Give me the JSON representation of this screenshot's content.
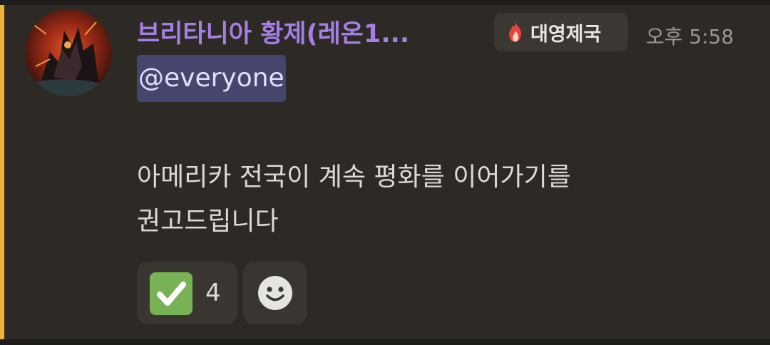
{
  "message": {
    "author": "브리타니아 황제(레온1...",
    "role_tag": {
      "icon": "fire-emoji-icon",
      "label": "대영제국"
    },
    "timestamp": "오후 5:58",
    "mention": "@everyone",
    "content_lines": [
      "아메리카 전국이 계속 평화를 이어가기를",
      "권고드립니다"
    ],
    "reactions": [
      {
        "emoji": "check-mark-button-icon",
        "count": "4"
      }
    ],
    "add_reaction_icon": "add-reaction-smile-icon"
  },
  "colors": {
    "background": "#2d2a26",
    "mention_highlight_bar": "#f0b232",
    "username": "#a77ee8",
    "mention_bg": "#46456e",
    "mention_text": "#dee0fc",
    "check_green": "#77b255"
  }
}
